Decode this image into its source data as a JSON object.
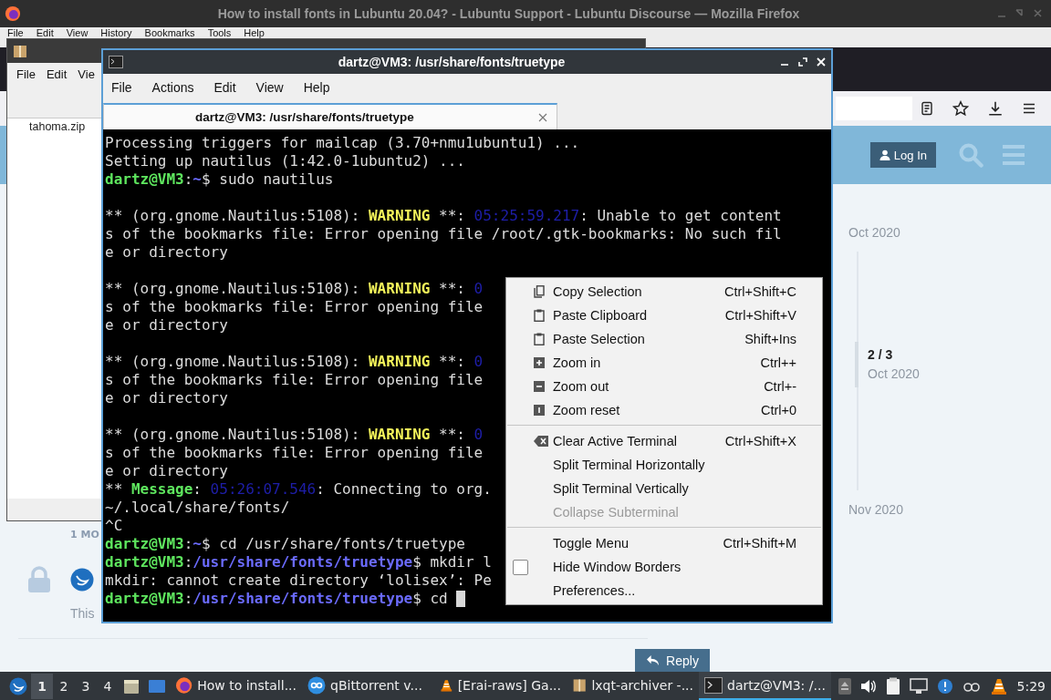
{
  "firefox": {
    "title": "How to install fonts in Lubuntu 20.04? - Lubuntu Support - Lubuntu Discourse — Mozilla Firefox",
    "menu": [
      "File",
      "Edit",
      "View",
      "History",
      "Bookmarks",
      "Tools",
      "Help"
    ]
  },
  "discourse": {
    "login": "Log In",
    "timeline": {
      "start": "Oct 2020",
      "position": "2 / 3",
      "position_date": "Oct 2020",
      "end": "Nov 2020"
    },
    "post": {
      "age": "1 MO",
      "excerpt": "This"
    },
    "reply": "Reply"
  },
  "archiver": {
    "menu": [
      "File",
      "Edit",
      "Vie"
    ],
    "files": [
      "tahoma.zip"
    ]
  },
  "terminal": {
    "title": "dartz@VM3: /usr/share/fonts/truetype",
    "menu": [
      "File",
      "Actions",
      "Edit",
      "View",
      "Help"
    ],
    "tabs": [
      {
        "label": "dartz@VM3: /usr/share/fonts/truetype",
        "selected": true
      }
    ],
    "lines": [
      {
        "kind": "output",
        "cursor": false,
        "segments": [
          {
            "kind": "plain",
            "text": "Processing triggers for mailcap (3.70+nmu1ubuntu1) ..."
          }
        ]
      },
      {
        "kind": "output",
        "cursor": false,
        "segments": [
          {
            "kind": "plain",
            "text": "Setting up nautilus (1:42.0-1ubuntu2) ..."
          }
        ]
      },
      {
        "kind": "output",
        "cursor": false,
        "segments": [
          {
            "kind": "user",
            "text": "dartz@VM3"
          },
          {
            "kind": "plain",
            "text": ":"
          },
          {
            "kind": "path",
            "text": "~"
          },
          {
            "kind": "plain",
            "text": "$ sudo nautilus"
          }
        ]
      },
      {
        "kind": "blank"
      },
      {
        "kind": "output",
        "cursor": false,
        "segments": [
          {
            "kind": "plain",
            "text": "** (org.gnome.Nautilus:5108): "
          },
          {
            "kind": "warning",
            "text": "WARNING"
          },
          {
            "kind": "plain",
            "text": " **: "
          },
          {
            "kind": "time",
            "text": "05:25:59.217"
          },
          {
            "kind": "plain",
            "text": ": Unable to get content"
          }
        ]
      },
      {
        "kind": "output",
        "cursor": false,
        "segments": [
          {
            "kind": "plain",
            "text": "s of the bookmarks file: Error opening file /root/.gtk-bookmarks: No such fil"
          }
        ]
      },
      {
        "kind": "output",
        "cursor": false,
        "segments": [
          {
            "kind": "plain",
            "text": "e or directory"
          }
        ]
      },
      {
        "kind": "blank"
      },
      {
        "kind": "output",
        "cursor": false,
        "segments": [
          {
            "kind": "plain",
            "text": "** (org.gnome.Nautilus:5108): "
          },
          {
            "kind": "warning",
            "text": "WARNING"
          },
          {
            "kind": "plain",
            "text": " **: "
          },
          {
            "kind": "time",
            "text": "0"
          }
        ]
      },
      {
        "kind": "output",
        "cursor": false,
        "segments": [
          {
            "kind": "plain",
            "text": "s of the bookmarks file: Error opening file"
          }
        ]
      },
      {
        "kind": "output",
        "cursor": false,
        "segments": [
          {
            "kind": "plain",
            "text": "e or directory"
          }
        ]
      },
      {
        "kind": "blank"
      },
      {
        "kind": "output",
        "cursor": false,
        "segments": [
          {
            "kind": "plain",
            "text": "** (org.gnome.Nautilus:5108): "
          },
          {
            "kind": "warning",
            "text": "WARNING"
          },
          {
            "kind": "plain",
            "text": " **: "
          },
          {
            "kind": "time",
            "text": "0"
          }
        ]
      },
      {
        "kind": "output",
        "cursor": false,
        "segments": [
          {
            "kind": "plain",
            "text": "s of the bookmarks file: Error opening file"
          }
        ]
      },
      {
        "kind": "output",
        "cursor": false,
        "segments": [
          {
            "kind": "plain",
            "text": "e or directory"
          }
        ]
      },
      {
        "kind": "blank"
      },
      {
        "kind": "output",
        "cursor": false,
        "segments": [
          {
            "kind": "plain",
            "text": "** (org.gnome.Nautilus:5108): "
          },
          {
            "kind": "warning",
            "text": "WARNING"
          },
          {
            "kind": "plain",
            "text": " **: "
          },
          {
            "kind": "time",
            "text": "0"
          }
        ]
      },
      {
        "kind": "output",
        "cursor": false,
        "segments": [
          {
            "kind": "plain",
            "text": "s of the bookmarks file: Error opening file"
          }
        ]
      },
      {
        "kind": "output",
        "cursor": false,
        "segments": [
          {
            "kind": "plain",
            "text": "e or directory"
          }
        ]
      },
      {
        "kind": "output",
        "cursor": false,
        "segments": [
          {
            "kind": "plain",
            "text": "** "
          },
          {
            "kind": "message",
            "text": "Message"
          },
          {
            "kind": "plain",
            "text": ": "
          },
          {
            "kind": "time",
            "text": "05:26:07.546"
          },
          {
            "kind": "plain",
            "text": ": Connecting to org."
          }
        ]
      },
      {
        "kind": "output",
        "cursor": false,
        "segments": [
          {
            "kind": "plain",
            "text": "~/.local/share/fonts/"
          }
        ]
      },
      {
        "kind": "output",
        "cursor": false,
        "segments": [
          {
            "kind": "plain",
            "text": "^C"
          }
        ]
      },
      {
        "kind": "output",
        "cursor": false,
        "segments": [
          {
            "kind": "user",
            "text": "dartz@VM3"
          },
          {
            "kind": "plain",
            "text": ":"
          },
          {
            "kind": "path",
            "text": "~"
          },
          {
            "kind": "plain",
            "text": "$ cd /usr/share/fonts/truetype"
          }
        ]
      },
      {
        "kind": "output",
        "cursor": false,
        "segments": [
          {
            "kind": "user",
            "text": "dartz@VM3"
          },
          {
            "kind": "plain",
            "text": ":"
          },
          {
            "kind": "path",
            "text": "/usr/share/fonts/truetype"
          },
          {
            "kind": "plain",
            "text": "$ mkdir l"
          }
        ]
      },
      {
        "kind": "output",
        "cursor": false,
        "segments": [
          {
            "kind": "plain",
            "text": "mkdir: cannot create directory ‘lolisex’: Pe"
          }
        ]
      },
      {
        "kind": "output",
        "cursor": true,
        "segments": [
          {
            "kind": "user",
            "text": "dartz@VM3"
          },
          {
            "kind": "plain",
            "text": ":"
          },
          {
            "kind": "path",
            "text": "/usr/share/fonts/truetype"
          },
          {
            "kind": "plain",
            "text": "$ cd "
          }
        ]
      }
    ]
  },
  "context_menu": {
    "sections": [
      [
        {
          "kind": "copy",
          "label": "Copy Selection",
          "shortcut": "Ctrl+Shift+C",
          "disabled": false
        },
        {
          "kind": "paste",
          "label": "Paste Clipboard",
          "shortcut": "Ctrl+Shift+V",
          "disabled": false
        },
        {
          "kind": "paste",
          "label": "Paste Selection",
          "shortcut": "Shift+Ins",
          "disabled": false
        },
        {
          "kind": "zoom-in",
          "label": "Zoom in",
          "shortcut": "Ctrl++",
          "disabled": false
        },
        {
          "kind": "zoom-out",
          "label": "Zoom out",
          "shortcut": "Ctrl+-",
          "disabled": false
        },
        {
          "kind": "zoom-reset",
          "label": "Zoom reset",
          "shortcut": "Ctrl+0",
          "disabled": false
        }
      ],
      [
        {
          "kind": "clear",
          "label": "Clear Active Terminal",
          "shortcut": "Ctrl+Shift+X",
          "disabled": false
        },
        {
          "kind": "plain",
          "label": "Split Terminal Horizontally",
          "disabled": false
        },
        {
          "kind": "plain",
          "label": "Split Terminal Vertically",
          "disabled": false
        },
        {
          "kind": "plain",
          "label": "Collapse Subterminal",
          "disabled": true
        }
      ],
      [
        {
          "kind": "plain",
          "label": "Toggle Menu",
          "shortcut": "Ctrl+Shift+M",
          "disabled": false
        },
        {
          "kind": "check",
          "label": "Hide Window Borders",
          "checked": false,
          "disabled": false
        },
        {
          "kind": "plain",
          "label": "Preferences...",
          "disabled": false
        }
      ]
    ]
  },
  "taskbar": {
    "desktops": [
      {
        "label": "1",
        "selected": true
      },
      {
        "label": "2",
        "selected": false
      },
      {
        "label": "3",
        "selected": false
      },
      {
        "label": "4",
        "selected": false
      }
    ],
    "tasks": [
      {
        "kind": "firefox",
        "label": "How to install...",
        "active": false
      },
      {
        "kind": "qbittorrent",
        "label": "qBittorrent v...",
        "active": false
      },
      {
        "kind": "vlc",
        "label": "[Erai-raws] Ga...",
        "active": false
      },
      {
        "kind": "archiver",
        "label": "lxqt-archiver -...",
        "active": false
      },
      {
        "kind": "terminal",
        "label": "dartz@VM3: /...",
        "active": true
      }
    ],
    "clock": "5:29"
  }
}
